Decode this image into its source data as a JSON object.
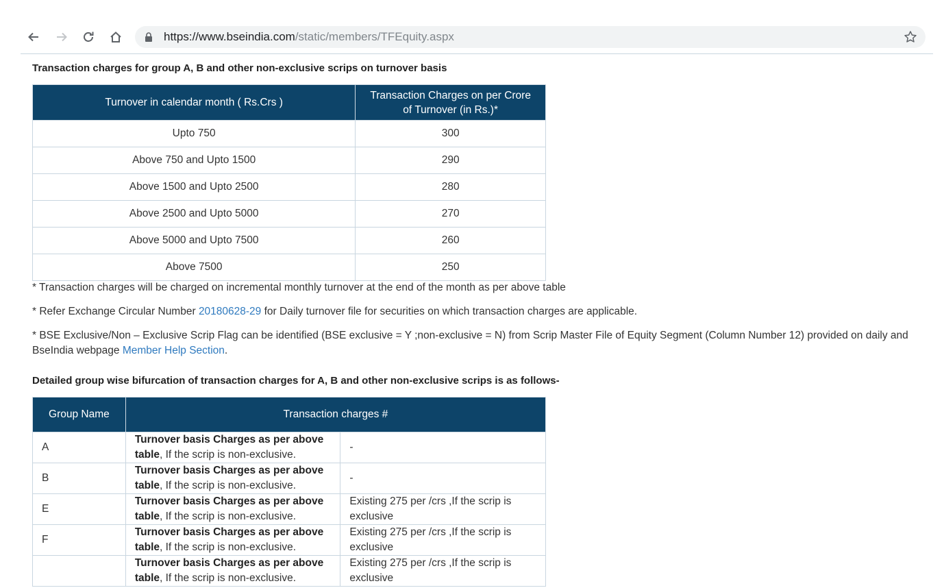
{
  "browser": {
    "url_host": "https://www.bseindia.com",
    "url_path": "/static/members/TFEquity.aspx"
  },
  "heading1": "Transaction charges for group A, B and other non-exclusive scrips on turnover basis",
  "table1": {
    "headers": [
      "Turnover in calendar month ( Rs.Crs )",
      "Transaction Charges on per Crore of Turnover (in Rs.)*"
    ],
    "rows": [
      [
        "Upto 750",
        "300"
      ],
      [
        "Above 750 and Upto 1500",
        "290"
      ],
      [
        "Above 1500 and Upto 2500",
        "280"
      ],
      [
        "Above 2500 and Upto 5000",
        "270"
      ],
      [
        "Above 5000 and Upto 7500",
        "260"
      ],
      [
        "Above 7500",
        "250"
      ]
    ]
  },
  "notes": {
    "note1": "* Transaction charges will be charged on incremental monthly turnover at the end of the month as per above table",
    "note2_prefix": "* Refer Exchange Circular Number ",
    "note2_link": "20180628-29",
    "note2_suffix": " for Daily turnover file for securities on which transaction charges are applicable.",
    "note3_text": "* BSE Exclusive/Non – Exclusive Scrip Flag can be identified (BSE exclusive = Y ;non-exclusive = N) from Scrip Master File of Equity Segment (Column Number 12) provided on daily and BseIndia webpage ",
    "note3_link": "Member Help Section",
    "note3_suffix": "."
  },
  "heading2": "Detailed group wise bifurcation of transaction charges for A, B and other non-exclusive scrips is as follows-",
  "table2": {
    "headers": [
      "Group Name",
      "Transaction charges #"
    ],
    "bold_text": "Turnover basis Charges as per above table",
    "plain_text": ", If the scrip is non-exclusive.",
    "rows": [
      {
        "group": "A",
        "extra": "-"
      },
      {
        "group": "B",
        "extra": "-"
      },
      {
        "group": "E",
        "extra": "Existing 275 per /crs ,If the scrip is exclusive"
      },
      {
        "group": "F",
        "extra": "Existing 275 per /crs ,If the scrip is exclusive"
      },
      {
        "group": "",
        "extra": "Existing 275 per /crs ,If the scrip is exclusive"
      }
    ]
  }
}
